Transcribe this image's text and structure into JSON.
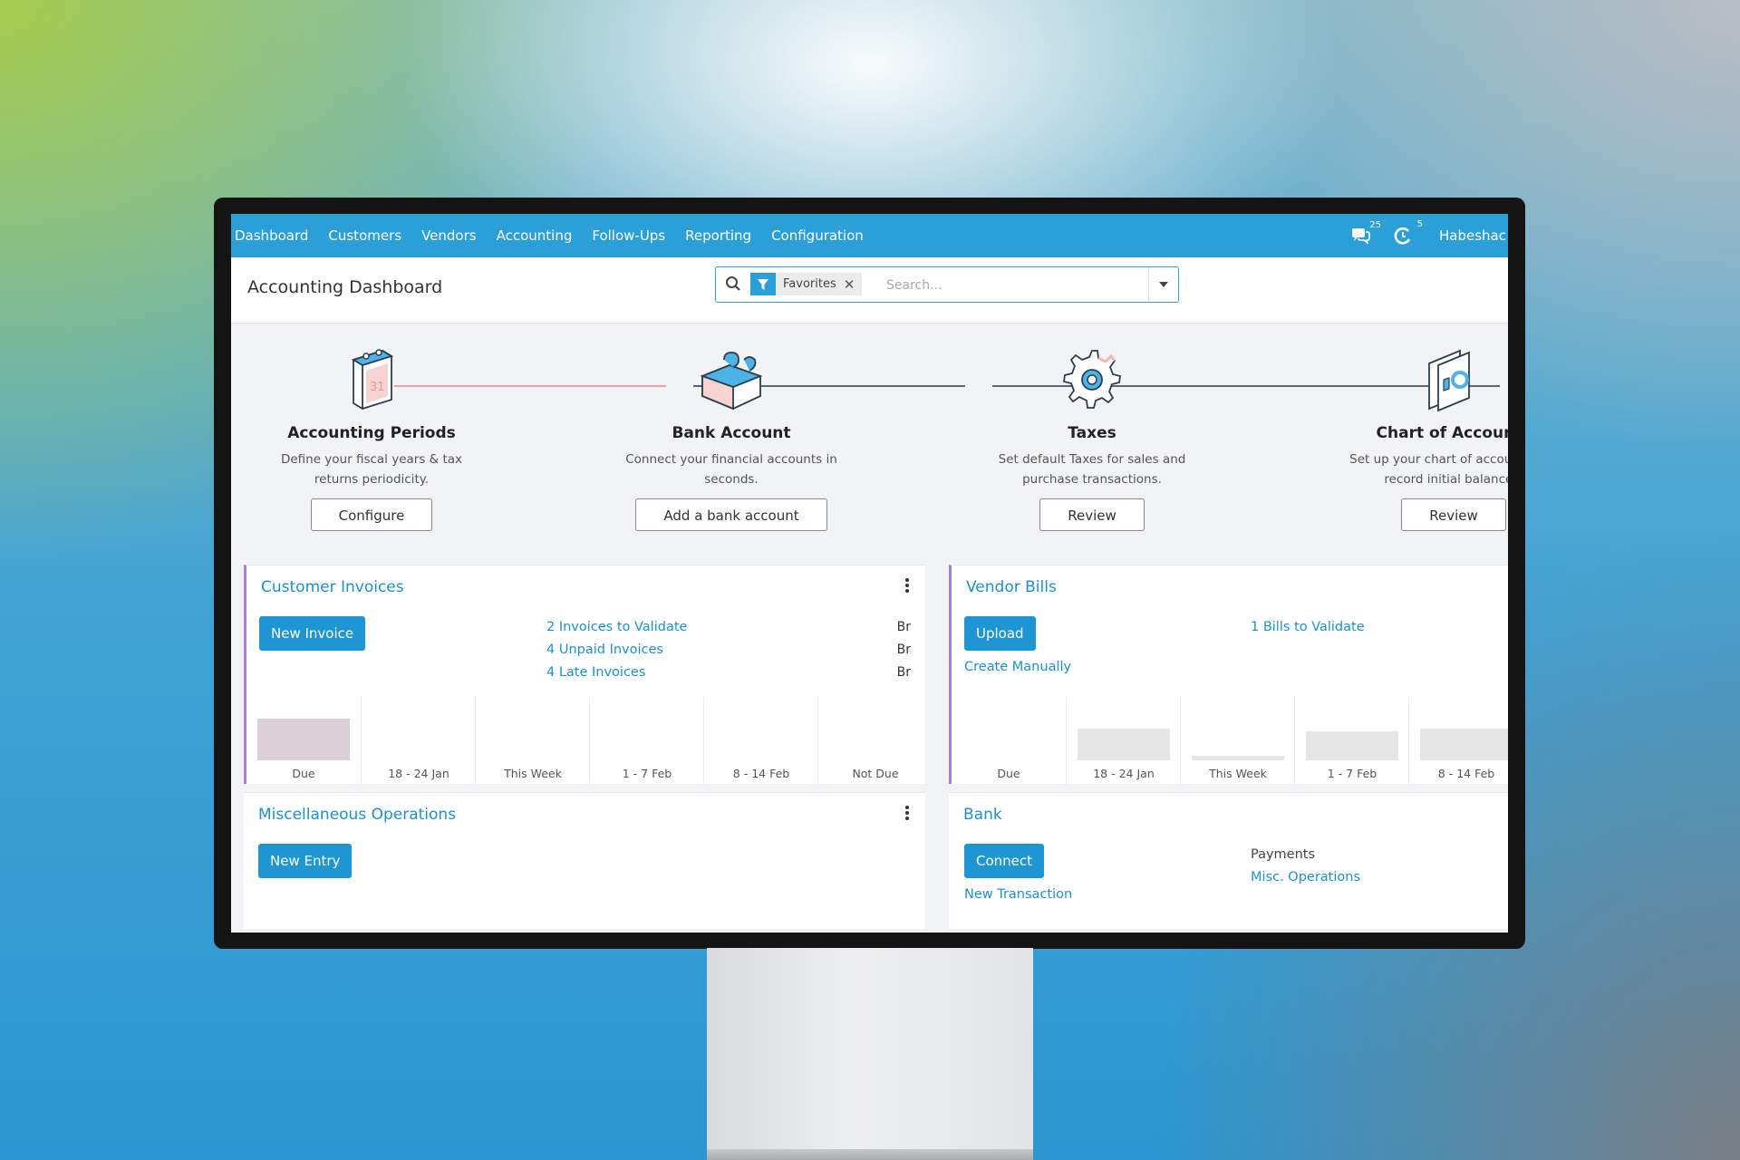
{
  "navbar": {
    "items": [
      "Dashboard",
      "Customers",
      "Vendors",
      "Accounting",
      "Follow-Ups",
      "Reporting",
      "Configuration"
    ],
    "messages_count": "25",
    "activities_count": "5",
    "user_name": "Habeshac"
  },
  "control": {
    "title": "Accounting Dashboard",
    "facet_label": "Favorites",
    "search_placeholder": "Search..."
  },
  "onboarding": {
    "steps": [
      {
        "title": "Accounting Periods",
        "description": "Define your fiscal years & tax returns periodicity.",
        "button": "Configure"
      },
      {
        "title": "Bank Account",
        "description": "Connect your financial accounts in seconds.",
        "button": "Add a bank account"
      },
      {
        "title": "Taxes",
        "description": "Set default Taxes for sales and purchase transactions.",
        "button": "Review"
      },
      {
        "title": "Chart of Accounts",
        "description": "Set up your chart of accounts and record initial balances.",
        "button": "Review"
      }
    ]
  },
  "customer_invoices": {
    "title": "Customer Invoices",
    "button": "New Invoice",
    "links": [
      "2 Invoices to Validate",
      "4 Unpaid Invoices",
      "4 Late Invoices"
    ],
    "amounts": [
      "Br",
      "Br",
      "Br"
    ],
    "graph_labels": [
      "Due",
      "18 - 24 Jan",
      "This Week",
      "1 - 7 Feb",
      "8 - 14 Feb",
      "Not Due"
    ],
    "graph_values": [
      0.72,
      0,
      0,
      0,
      0,
      0
    ]
  },
  "vendor_bills": {
    "title": "Vendor Bills",
    "button": "Upload",
    "secondary": "Create Manually",
    "links": [
      "1 Bills to Validate"
    ],
    "graph_labels": [
      "Due",
      "18 - 24 Jan",
      "This Week",
      "1 - 7 Feb",
      "8 - 14 Feb"
    ],
    "graph_values": [
      0,
      0.55,
      0.08,
      0.5,
      0.55
    ]
  },
  "misc_operations": {
    "title": "Miscellaneous Operations",
    "button": "New Entry"
  },
  "bank": {
    "title": "Bank",
    "button": "Connect",
    "secondary": "New Transaction",
    "label": "Payments",
    "link": "Misc. Operations"
  },
  "colors": {
    "brand": "#2a9fd8",
    "link": "#1f90cc",
    "accent_border": "#a77ee0"
  }
}
